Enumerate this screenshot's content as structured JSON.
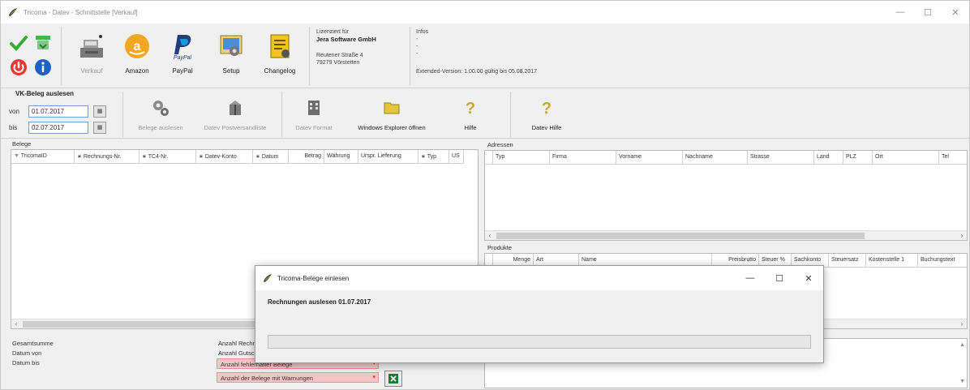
{
  "window": {
    "title": "Tricoma - Datev - Schnittstelle [Verkauf]",
    "controls": {
      "minimize": "—",
      "maximize": "☐",
      "close": "✕"
    }
  },
  "ribbon": {
    "buttons": [
      {
        "label": "Verkauf",
        "icon": "cash-register-icon",
        "disabled": true
      },
      {
        "label": "Amazon",
        "icon": "amazon-icon",
        "disabled": false
      },
      {
        "label": "PayPal",
        "icon": "paypal-icon",
        "disabled": false
      },
      {
        "label": "Setup",
        "icon": "setup-icon",
        "disabled": false
      },
      {
        "label": "Changelog",
        "icon": "changelog-icon",
        "disabled": false
      }
    ],
    "license": {
      "line1": "Lizenziert für",
      "company": "Jera Software GmbH",
      "street": "Reutener Straße 4",
      "city": "79279 Vörstetten"
    },
    "info": {
      "title": "Infos",
      "line1": "-",
      "line2": "-",
      "line3": "-",
      "version": "Extended-Version: 1.00.00 gültig bis 05.08.2017"
    }
  },
  "toolbar2": {
    "group_title": "VK-Beleg auslesen",
    "from_label": "von",
    "from_value": "01.07.2017",
    "to_label": "bis",
    "to_value": "02.07.2017",
    "buttons": [
      {
        "label": "Belege auslesen",
        "disabled": true
      },
      {
        "label": "Datev Postversandliste",
        "disabled": true
      },
      {
        "label": "Datev Format",
        "disabled": true
      },
      {
        "label": "Windows Explorer öffnen",
        "disabled": false
      },
      {
        "label": "Hilfe",
        "disabled": false
      },
      {
        "label": "Datev Hilfe",
        "disabled": false
      }
    ]
  },
  "belege": {
    "label": "Belege",
    "columns": [
      "TricomaID",
      "Rechnungs-Nr.",
      "TC4-Nr.",
      "Datev-Konto",
      "Datum",
      "Betrag",
      "Währung",
      "Urspr. Lieferung",
      "Typ",
      "US"
    ]
  },
  "adressen": {
    "label": "Adressen",
    "columns": [
      "Typ",
      "Firma",
      "Vorname",
      "Nachname",
      "Strasse",
      "Land",
      "PLZ",
      "Ort",
      "Tel"
    ]
  },
  "produkte": {
    "label": "Produkte",
    "columns": [
      "Menge",
      "Art",
      "Name",
      "Preisbrutto",
      "Steuer %",
      "Sachkonto",
      "Steuersatz",
      "Kostenstelle 1",
      "Buchungstext"
    ]
  },
  "summary": {
    "total_label": "Gesamtsumme",
    "date_from_label": "Datum von",
    "date_to_label": "Datum bis",
    "count_invoices_label": "Anzahl Rechnungen",
    "count_credits_label": "Anzahl Gutschriften",
    "count_errors_label": "Anzahl fehlerhafter Belege",
    "count_warnings_label": "Anzahl der Belege mit Warnungen"
  },
  "dialog": {
    "title": "Tricoma-Belege einlesen",
    "message": "Rechnungen auslesen 01.07.2017",
    "progress": 0
  }
}
